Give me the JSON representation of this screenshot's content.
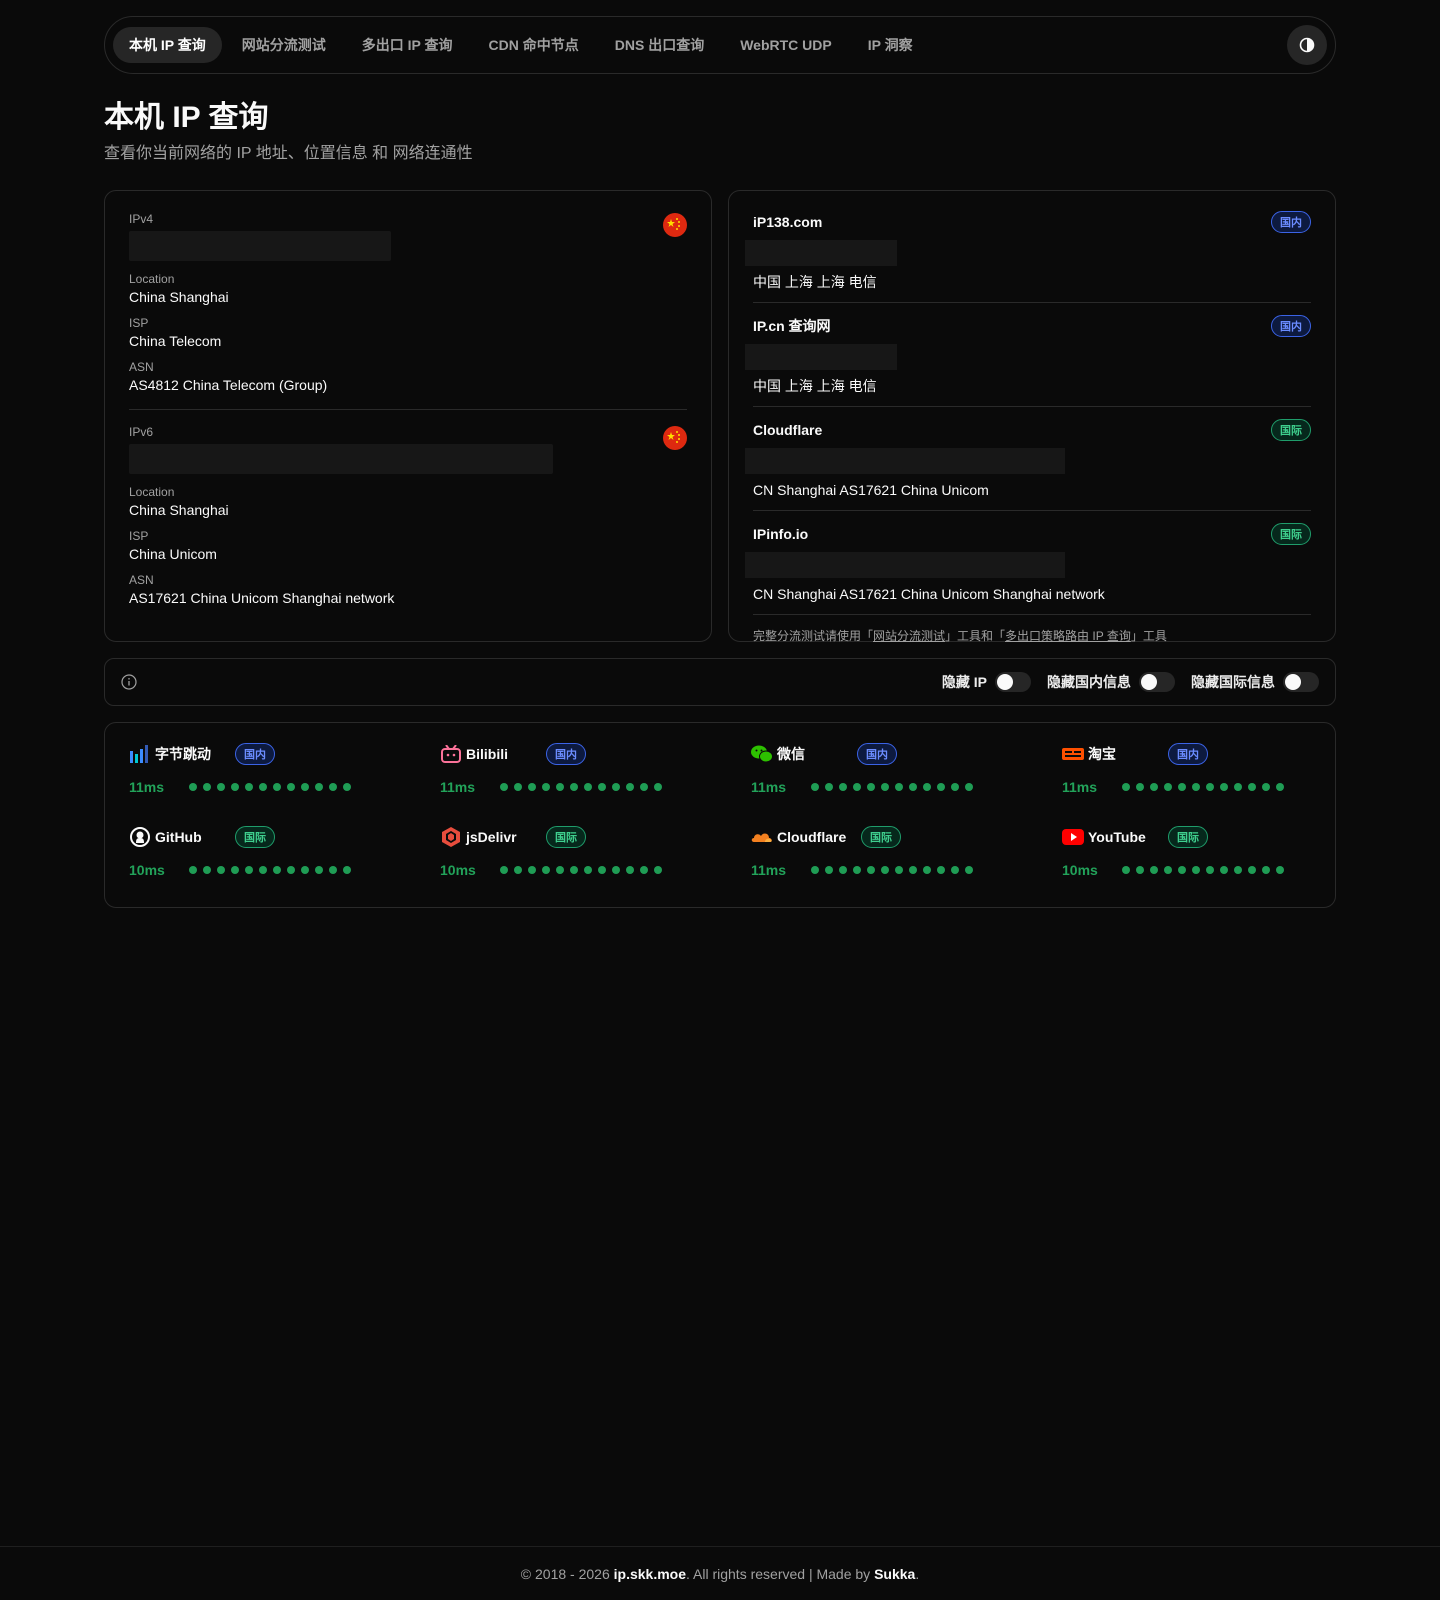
{
  "nav": {
    "tabs": [
      {
        "label": "本机 IP 查询",
        "active": true
      },
      {
        "label": "网站分流测试"
      },
      {
        "label": "多出口 IP 查询"
      },
      {
        "label": "CDN 命中节点"
      },
      {
        "label": "DNS 出口查询"
      },
      {
        "label": "WebRTC UDP"
      },
      {
        "label": "IP 洞察"
      }
    ],
    "theme_icon": "contrast-icon"
  },
  "header": {
    "title": "本机 IP 查询",
    "subtitle": "查看你当前网络的 IP 地址、位置信息 和 网络连通性"
  },
  "ipv4": {
    "label": "IPv4",
    "location_label": "Location",
    "location": "China Shanghai",
    "isp_label": "ISP",
    "isp": "China Telecom",
    "asn_label": "ASN",
    "asn": "AS4812 China Telecom (Group)"
  },
  "ipv6": {
    "label": "IPv6",
    "location_label": "Location",
    "location": "China Shanghai",
    "isp_label": "ISP",
    "isp": "China Unicom",
    "asn_label": "ASN",
    "asn": "AS17621 China Unicom Shanghai network"
  },
  "providers": [
    {
      "name": "iP138.com",
      "badge": "国内",
      "location": "中国 上海 上海 电信"
    },
    {
      "name": "IP.cn 查询网",
      "badge": "国内",
      "location": "中国 上海 上海 电信"
    },
    {
      "name": "Cloudflare",
      "badge": "国际",
      "location": "CN Shanghai AS17621 China Unicom"
    },
    {
      "name": "IPinfo.io",
      "badge": "国际",
      "location": "CN Shanghai AS17621 China Unicom Shanghai network"
    }
  ],
  "note": {
    "prefix": "完整分流测试请使用「",
    "link1": "网站分流测试",
    "middle": "」工具和「",
    "link2": "多出口策略路由 IP 查询",
    "suffix": "」工具"
  },
  "toggles": {
    "hide_ip": "隐藏 IP",
    "hide_domestic": "隐藏国内信息",
    "hide_intl": "隐藏国际信息"
  },
  "sites": [
    {
      "name": "字节跳动",
      "badge": "国内",
      "ms": "11ms",
      "icon": "bytedance-icon"
    },
    {
      "name": "Bilibili",
      "badge": "国内",
      "ms": "11ms",
      "icon": "bilibili-icon"
    },
    {
      "name": "微信",
      "badge": "国内",
      "ms": "11ms",
      "icon": "wechat-icon"
    },
    {
      "name": "淘宝",
      "badge": "国内",
      "ms": "11ms",
      "icon": "taobao-icon"
    },
    {
      "name": "GitHub",
      "badge": "国际",
      "ms": "10ms",
      "icon": "github-icon"
    },
    {
      "name": "jsDelivr",
      "badge": "国际",
      "ms": "10ms",
      "icon": "jsdelivr-icon"
    },
    {
      "name": "Cloudflare",
      "badge": "国际",
      "ms": "11ms",
      "icon": "cloudflare-icon"
    },
    {
      "name": "YouTube",
      "badge": "国际",
      "ms": "10ms",
      "icon": "youtube-icon"
    }
  ],
  "footer": {
    "prefix": "© 2018 - 2026 ",
    "site": "ip.skk.moe",
    "middle": ". All rights reserved | Made by ",
    "author": "Sukka",
    "suffix": "."
  },
  "colors": {
    "background": "#0a0a0a",
    "domestic_badge": "#3b63e6",
    "intl_badge": "#1f9d6b",
    "latency_green": "#22a35a"
  }
}
